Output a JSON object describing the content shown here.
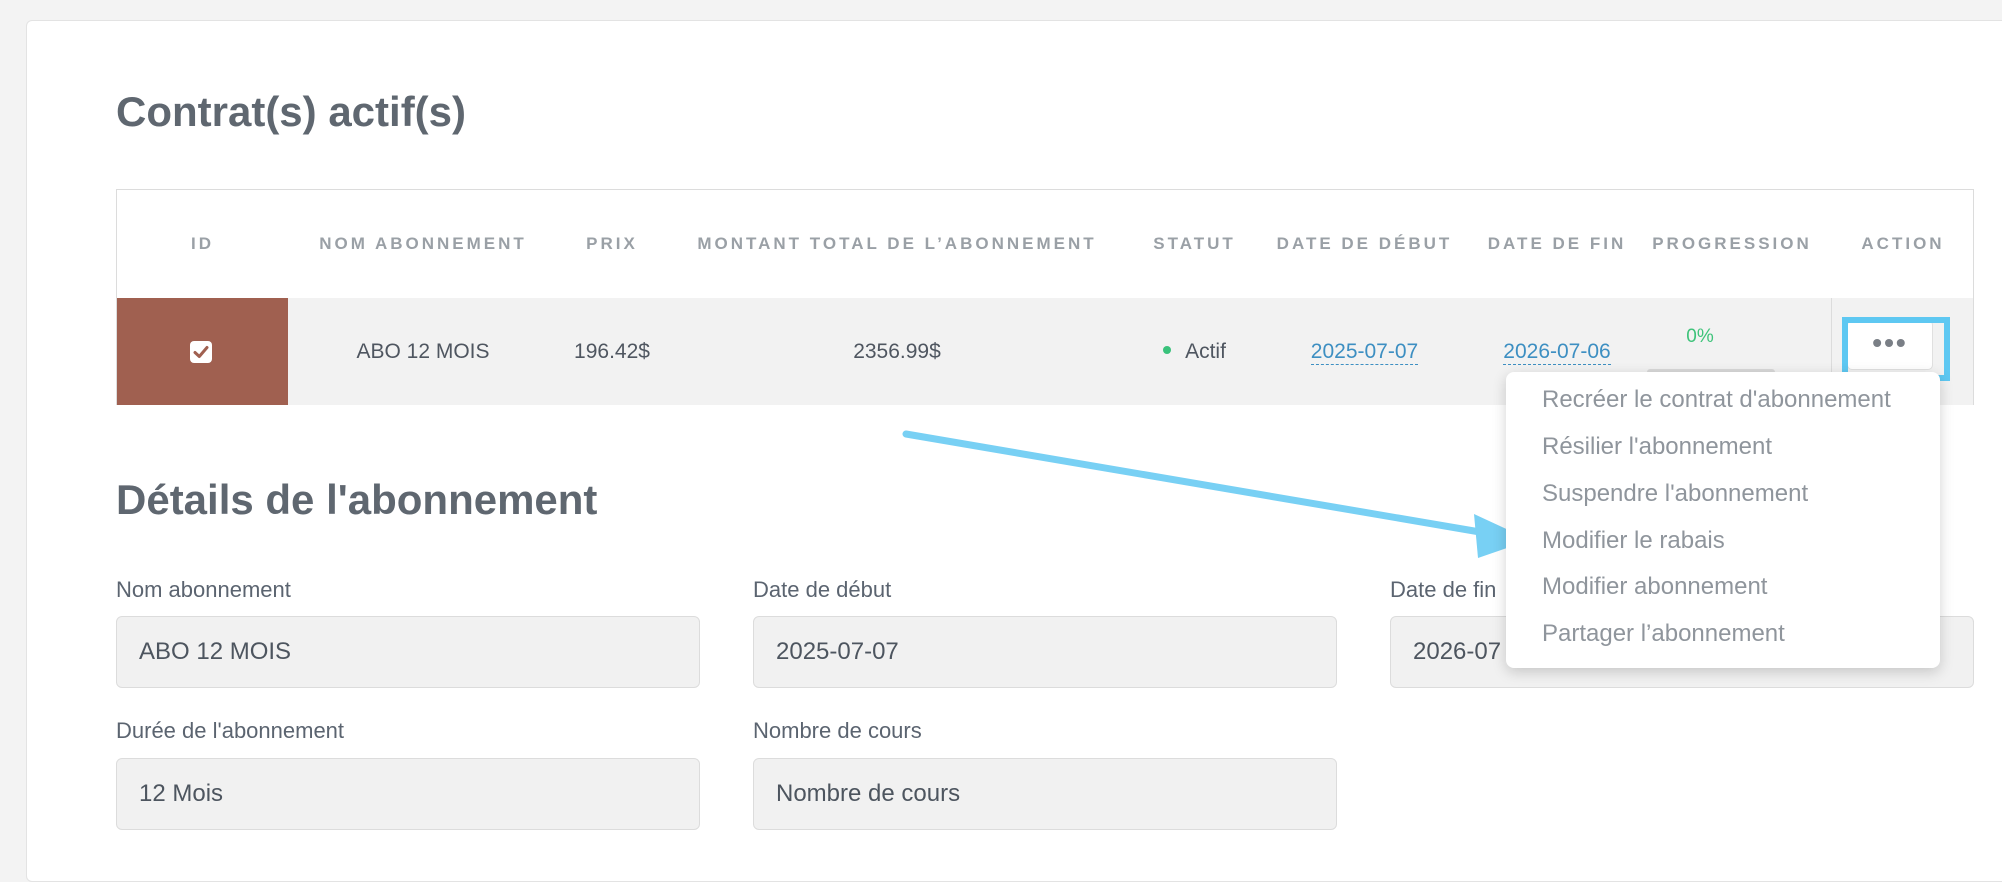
{
  "sections": {
    "contracts_title": "Contrat(s) actif(s)",
    "details_title": "Détails de l'abonnement"
  },
  "table": {
    "headers": [
      "ID",
      "NOM ABONNEMENT",
      "PRIX",
      "MONTANT TOTAL DE L’ABONNEMENT",
      "STATUT",
      "DATE DE DÉBUT",
      "DATE DE FIN",
      "PROGRESSION",
      "ACTION"
    ],
    "row": {
      "checked": true,
      "name": "ABO 12 MOIS",
      "price": "196.42$",
      "total": "2356.99$",
      "status": "Actif",
      "start_date": "2025-07-07",
      "end_date": "2026-07-06",
      "progression": "0%",
      "progress_fraction": 0.0
    }
  },
  "action_menu": {
    "button_glyph": "•••",
    "items": [
      "Recréer le contrat d'abonnement",
      "Résilier l'abonnement",
      "Suspendre l'abonnement",
      "Modifier le rabais",
      "Modifier abonnement",
      "Partager l’abonnement"
    ]
  },
  "details": {
    "name_label": "Nom abonnement",
    "name_value": "ABO 12 MOIS",
    "start_label": "Date de début",
    "start_value": "2025-07-07",
    "end_label": "Date de fin",
    "end_value": "2026-07",
    "duration_label": "Durée de l'abonnement",
    "duration_value": "12 Mois",
    "courses_label": "Nombre de cours",
    "courses_placeholder": "Nombre de cours"
  },
  "colors": {
    "id_cell": "#a06050",
    "status_active": "#39c27b",
    "link": "#3d8fc2",
    "annotation": "#5ec8f2"
  }
}
